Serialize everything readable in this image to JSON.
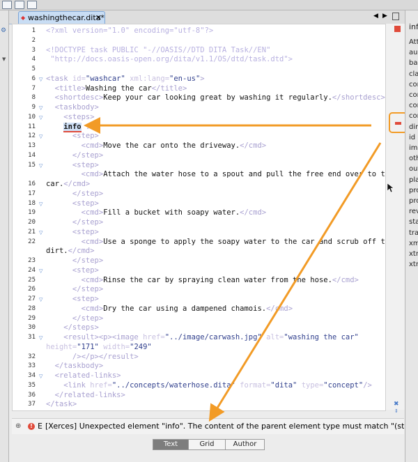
{
  "editor": {
    "tab_label": "washingthecar.dita*",
    "lines": [
      {
        "n": "1",
        "fold": false,
        "parts": [
          [
            "pi",
            "<?xml version=\"1.0\" encoding=\"utf-8\"?>"
          ]
        ]
      },
      {
        "n": "2",
        "fold": false,
        "parts": []
      },
      {
        "n": "3",
        "fold": false,
        "parts": [
          [
            "pi",
            "<!DOCTYPE task PUBLIC \"-//OASIS//DTD DITA Task//EN\""
          ]
        ]
      },
      {
        "n": "4",
        "fold": false,
        "parts": [
          [
            "pi",
            " \"http://docs.oasis-open.org/dita/v1.1/OS/dtd/task.dtd\">"
          ]
        ]
      },
      {
        "n": "5",
        "fold": false,
        "parts": []
      },
      {
        "n": "6",
        "fold": true,
        "parts": [
          [
            "tag",
            "<task "
          ],
          [
            "attr",
            "id="
          ],
          [
            "val",
            "\"washcar\" "
          ],
          [
            "attr",
            "xml:lang="
          ],
          [
            "val",
            "\"en-us\""
          ],
          [
            "tag",
            ">"
          ]
        ]
      },
      {
        "n": "7",
        "fold": false,
        "parts": [
          [
            "tag",
            "  <title>"
          ],
          [
            "txt",
            "Washing the car"
          ],
          [
            "tag",
            "</title>"
          ]
        ]
      },
      {
        "n": "8",
        "fold": false,
        "parts": [
          [
            "tag",
            "  <shortdesc>"
          ],
          [
            "txt",
            "Keep your car looking great by washing it regularly."
          ],
          [
            "tag",
            "</shortdesc>"
          ]
        ]
      },
      {
        "n": "9",
        "fold": true,
        "parts": [
          [
            "tag",
            "  <taskbody>"
          ]
        ]
      },
      {
        "n": "10",
        "fold": true,
        "parts": [
          [
            "tag",
            "    <steps>"
          ]
        ]
      },
      {
        "n": "11",
        "fold": false,
        "parts": [
          [
            "txt",
            "    "
          ],
          [
            "hl",
            "info"
          ],
          [
            "tag",
            " ."
          ]
        ]
      },
      {
        "n": "12",
        "fold": true,
        "parts": [
          [
            "tag",
            "      <step>"
          ]
        ]
      },
      {
        "n": "13",
        "fold": false,
        "parts": [
          [
            "tag",
            "        <cmd>"
          ],
          [
            "txt",
            "Move the car onto the driveway."
          ],
          [
            "tag",
            "</cmd>"
          ]
        ]
      },
      {
        "n": "14",
        "fold": false,
        "parts": [
          [
            "tag",
            "      </step>"
          ]
        ]
      },
      {
        "n": "15",
        "fold": true,
        "parts": [
          [
            "tag",
            "      <step>"
          ]
        ]
      },
      {
        "n": "",
        "fold": false,
        "parts": [
          [
            "tag",
            "        <cmd>"
          ],
          [
            "txt",
            "Attach the water hose to a spout and pull the free end over to the"
          ]
        ]
      },
      {
        "n": "16",
        "fold": false,
        "parts": [
          [
            "txt",
            "car."
          ],
          [
            "tag",
            "</cmd>"
          ]
        ]
      },
      {
        "n": "17",
        "fold": false,
        "parts": [
          [
            "tag",
            "      </step>"
          ]
        ]
      },
      {
        "n": "18",
        "fold": true,
        "parts": [
          [
            "tag",
            "      <step>"
          ]
        ]
      },
      {
        "n": "19",
        "fold": false,
        "parts": [
          [
            "tag",
            "        <cmd>"
          ],
          [
            "txt",
            "Fill a bucket with soapy water."
          ],
          [
            "tag",
            "</cmd>"
          ]
        ]
      },
      {
        "n": "20",
        "fold": false,
        "parts": [
          [
            "tag",
            "      </step>"
          ]
        ]
      },
      {
        "n": "21",
        "fold": true,
        "parts": [
          [
            "tag",
            "      <step>"
          ]
        ]
      },
      {
        "n": "22",
        "fold": false,
        "parts": [
          [
            "tag",
            "        <cmd>"
          ],
          [
            "txt",
            "Use a sponge to apply the soapy water to the car and scrub off the"
          ]
        ]
      },
      {
        "n": "",
        "fold": false,
        "parts": [
          [
            "txt",
            "dirt."
          ],
          [
            "tag",
            "</cmd>"
          ]
        ]
      },
      {
        "n": "23",
        "fold": false,
        "parts": [
          [
            "tag",
            "      </step>"
          ]
        ]
      },
      {
        "n": "24",
        "fold": true,
        "parts": [
          [
            "tag",
            "      <step>"
          ]
        ]
      },
      {
        "n": "25",
        "fold": false,
        "parts": [
          [
            "tag",
            "        <cmd>"
          ],
          [
            "txt",
            "Rinse the car by spraying clean water from the hose."
          ],
          [
            "tag",
            "</cmd>"
          ]
        ]
      },
      {
        "n": "26",
        "fold": false,
        "parts": [
          [
            "tag",
            "      </step>"
          ]
        ]
      },
      {
        "n": "27",
        "fold": true,
        "parts": [
          [
            "tag",
            "      <step>"
          ]
        ]
      },
      {
        "n": "28",
        "fold": false,
        "parts": [
          [
            "tag",
            "        <cmd>"
          ],
          [
            "txt",
            "Dry the car using a dampened chamois."
          ],
          [
            "tag",
            "</cmd>"
          ]
        ]
      },
      {
        "n": "29",
        "fold": false,
        "parts": [
          [
            "tag",
            "      </step>"
          ]
        ]
      },
      {
        "n": "30",
        "fold": false,
        "parts": [
          [
            "tag",
            "    </steps>"
          ]
        ]
      },
      {
        "n": "31",
        "fold": true,
        "parts": [
          [
            "tag",
            "    <result><p><image "
          ],
          [
            "attr",
            "href="
          ],
          [
            "val",
            "\"../image/carwash.jpg\" "
          ],
          [
            "attr",
            "alt="
          ],
          [
            "val",
            "\"washing the car\""
          ]
        ]
      },
      {
        "n": "",
        "fold": false,
        "parts": [
          [
            "attr",
            "height="
          ],
          [
            "val",
            "\"171\" "
          ],
          [
            "attr",
            "width="
          ],
          [
            "val",
            "\"249\""
          ]
        ]
      },
      {
        "n": "32",
        "fold": false,
        "parts": [
          [
            "tag",
            "      /></p></result>"
          ]
        ]
      },
      {
        "n": "33",
        "fold": false,
        "parts": [
          [
            "tag",
            "  </taskbody>"
          ]
        ]
      },
      {
        "n": "34",
        "fold": true,
        "parts": [
          [
            "tag",
            "  <related-links>"
          ]
        ]
      },
      {
        "n": "35",
        "fold": false,
        "parts": [
          [
            "tag",
            "    <link "
          ],
          [
            "attr",
            "href="
          ],
          [
            "val",
            "\"../concepts/waterhose.dita\" "
          ],
          [
            "attr",
            "format="
          ],
          [
            "val",
            "\"dita\" "
          ],
          [
            "attr",
            "type="
          ],
          [
            "val",
            "\"concept\""
          ],
          [
            "tag",
            "/>"
          ]
        ]
      },
      {
        "n": "36",
        "fold": false,
        "parts": [
          [
            "tag",
            "  </related-links>"
          ]
        ]
      },
      {
        "n": "37",
        "fold": false,
        "parts": [
          [
            "tag",
            "</task>"
          ]
        ]
      }
    ]
  },
  "right_panel": {
    "title": "info",
    "items": [
      "Att",
      "aud",
      "bas",
      "cla",
      "con",
      "con",
      "con",
      "con",
      "dir",
      "id",
      "imp",
      "oth",
      "out",
      "pla",
      "pro",
      "pro",
      "rev",
      "sta",
      "tra",
      "xm",
      "xtr",
      "xtr"
    ]
  },
  "error": {
    "severity": "E",
    "message": "[Xerces] Unexpected element \"info\". The content of the parent element type must match \"(step"
  },
  "modes": {
    "text": "Text",
    "grid": "Grid",
    "author": "Author"
  },
  "colors": {
    "arrow": "#f29b26",
    "error": "#e04a3a",
    "tab": "#c8ddf4",
    "accent": "#4a7cc9"
  }
}
